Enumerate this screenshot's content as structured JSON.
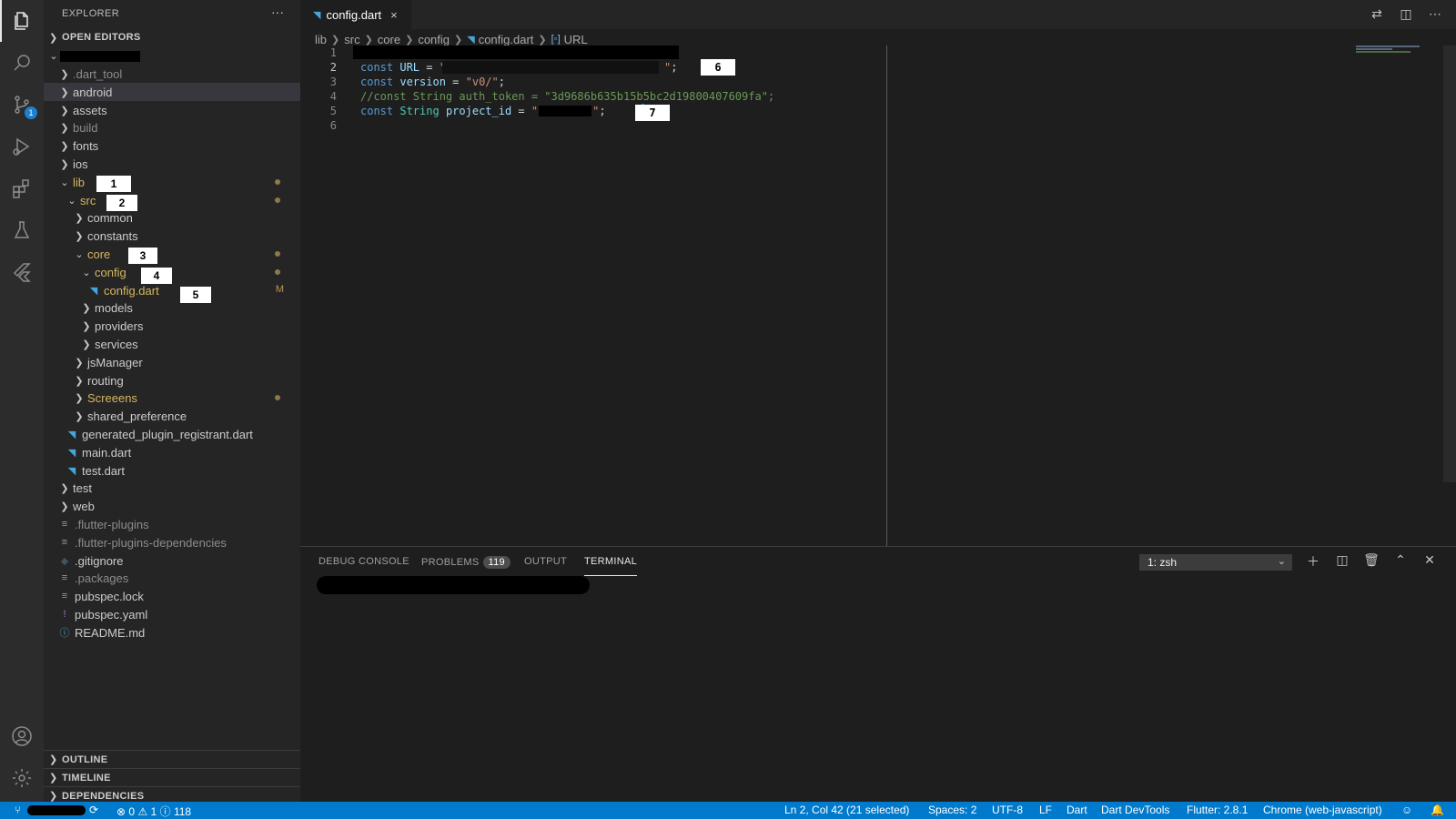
{
  "activity_bar": {
    "items": [
      {
        "icon": "files-icon"
      },
      {
        "icon": "search-icon"
      },
      {
        "icon": "source-control-icon",
        "badge": "1"
      },
      {
        "icon": "run-debug-icon"
      },
      {
        "icon": "extensions-icon"
      },
      {
        "icon": "testing-flask-icon"
      },
      {
        "icon": "flutter-icon"
      }
    ],
    "bottom": [
      {
        "icon": "account-icon"
      },
      {
        "icon": "settings-gear-icon"
      }
    ]
  },
  "explorer": {
    "title": "EXPLORER",
    "more": "···",
    "open_editors": "OPEN EDITORS",
    "tree": [
      {
        "label": ".dart_tool",
        "type": "folder",
        "dim": true
      },
      {
        "label": "android",
        "type": "folder"
      },
      {
        "label": "assets",
        "type": "folder"
      },
      {
        "label": "build",
        "type": "folder",
        "dim": true
      },
      {
        "label": "fonts",
        "type": "folder"
      },
      {
        "label": "ios",
        "type": "folder"
      },
      {
        "label": "lib",
        "type": "folder-open",
        "modified": true
      },
      {
        "label": "src",
        "type": "folder-open",
        "modified": true
      },
      {
        "label": "common",
        "type": "folder"
      },
      {
        "label": "constants",
        "type": "folder"
      },
      {
        "label": "core",
        "type": "folder-open",
        "modified": true
      },
      {
        "label": "config",
        "type": "folder-open",
        "modified": true
      },
      {
        "label": "config.dart",
        "type": "file",
        "modified": true,
        "flag": "M"
      },
      {
        "label": "models",
        "type": "folder"
      },
      {
        "label": "providers",
        "type": "folder"
      },
      {
        "label": "services",
        "type": "folder"
      },
      {
        "label": "jsManager",
        "type": "folder"
      },
      {
        "label": "routing",
        "type": "folder"
      },
      {
        "label": "Screeens",
        "type": "folder",
        "modified": true
      },
      {
        "label": "shared_preference",
        "type": "folder"
      },
      {
        "label": "generated_plugin_registrant.dart",
        "type": "file"
      },
      {
        "label": "main.dart",
        "type": "file"
      },
      {
        "label": "test.dart",
        "type": "file"
      },
      {
        "label": "test",
        "type": "folder"
      },
      {
        "label": "web",
        "type": "folder"
      },
      {
        "label": ".flutter-plugins",
        "type": "text",
        "dim": true
      },
      {
        "label": ".flutter-plugins-dependencies",
        "type": "text",
        "dim": true
      },
      {
        "label": ".gitignore",
        "type": "git"
      },
      {
        "label": ".packages",
        "type": "text",
        "dim": true
      },
      {
        "label": "pubspec.lock",
        "type": "text"
      },
      {
        "label": "pubspec.yaml",
        "type": "yaml"
      },
      {
        "label": "README.md",
        "type": "info"
      }
    ],
    "annotations": [
      "1",
      "2",
      "3",
      "4",
      "5"
    ],
    "outline": "OUTLINE",
    "timeline": "TIMELINE",
    "dependencies": "DEPENDENCIES"
  },
  "editor": {
    "tab_label": "config.dart",
    "tab_close": "×",
    "breadcrumb": [
      "lib",
      "src",
      "core",
      "config",
      "config.dart",
      "URL"
    ],
    "line_numbers": [
      "1",
      "2",
      "3",
      "4",
      "5",
      "6"
    ],
    "lines": {
      "l2_kw": "const",
      "l2_var": "URL",
      "l2_eq": " = ",
      "l2_q1": "\"",
      "l2_q2": "\"",
      "l2_end": ";",
      "l3_kw": "const",
      "l3_var": "version",
      "l3_eq": " = ",
      "l3_str": "\"v0/\"",
      "l3_end": ";",
      "l4_comment": "//const String auth_token = \"3d9686b635b15b5bc2d19800407609fa\";",
      "l5_kw": "const",
      "l5_ty": "String",
      "l5_var": "project_id",
      "l5_eq": " = ",
      "l5_q1": "\"",
      "l5_q2": "\"",
      "l5_end": ";"
    },
    "annotations": [
      "6",
      "7"
    ]
  },
  "panel": {
    "tabs": [
      "DEBUG CONSOLE",
      "PROBLEMS",
      "OUTPUT",
      "TERMINAL"
    ],
    "problems_count": "119",
    "active_tab": "TERMINAL",
    "terminal_select": "1: zsh"
  },
  "status_bar": {
    "errors": "0",
    "warnings": "1",
    "infos": "118",
    "cursor": "Ln 2, Col 42 (21 selected)",
    "spaces": "Spaces: 2",
    "encoding": "UTF-8",
    "eol": "LF",
    "language": "Dart",
    "devtools": "Dart DevTools",
    "flutter": "Flutter: 2.8.1",
    "device": "Chrome (web-javascript)"
  },
  "colors": {
    "status_bar": "#007acc",
    "activity_bar": "#2c2c2c",
    "sidebar": "#252526",
    "editor": "#1e1e1e",
    "modified": "#d7b65e"
  }
}
